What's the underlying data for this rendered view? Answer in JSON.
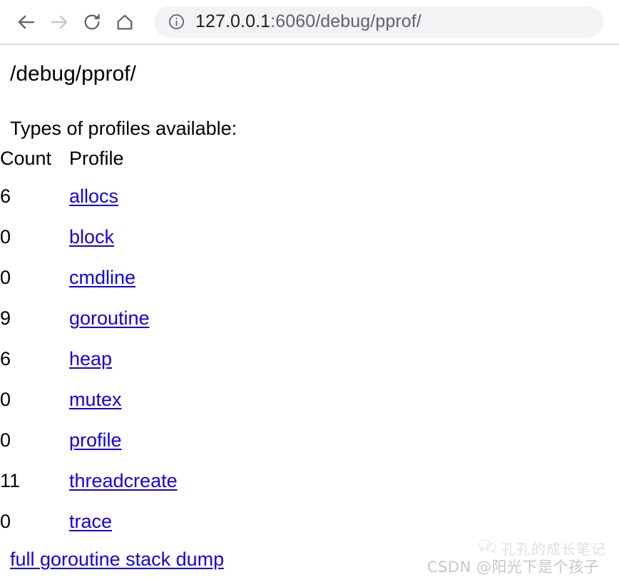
{
  "browser": {
    "back_icon": "back-arrow-icon",
    "forward_icon": "forward-arrow-icon",
    "reload_icon": "reload-icon",
    "home_icon": "home-icon",
    "site_info_icon": "info-circle-icon",
    "url_host": "127.0.0.1",
    "url_rest": ":6060/debug/pprof/",
    "url_full": "127.0.0.1:6060/debug/pprof/",
    "colors": {
      "enabled_icon": "#5f6368",
      "disabled_icon": "#c4c7c5",
      "address_bar_bg": "#f1f3f4",
      "url_host_text": "#202124",
      "url_rest_text": "#5f6368"
    }
  },
  "page": {
    "heading": "/debug/pprof/",
    "profiles_available_label": "Types of profiles available:",
    "table": {
      "count_header": "Count",
      "profile_header": "Profile",
      "rows": [
        {
          "count": "6",
          "profile": "allocs"
        },
        {
          "count": "0",
          "profile": "block"
        },
        {
          "count": "0",
          "profile": "cmdline"
        },
        {
          "count": "9",
          "profile": "goroutine"
        },
        {
          "count": "6",
          "profile": "heap"
        },
        {
          "count": "0",
          "profile": "mutex"
        },
        {
          "count": "0",
          "profile": "profile"
        },
        {
          "count": "11",
          "profile": "threadcreate"
        },
        {
          "count": "0",
          "profile": "trace"
        }
      ]
    },
    "full_goroutine_stack_dump": "full goroutine stack dump",
    "link_color": "#1400e6",
    "text_color": "#000000"
  },
  "watermarks": {
    "wechat_logo_icon": "wechat-logo-icon",
    "wechat_text": "孔孔的成长笔记",
    "csdn_text": "CSDN @阳光下是个孩子"
  }
}
